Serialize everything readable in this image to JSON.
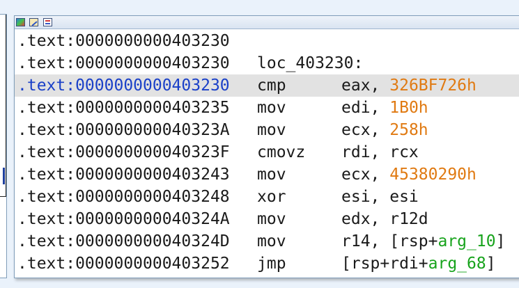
{
  "listing": {
    "lines": [
      {
        "addr": ".text:0000000000403230",
        "mnemonic": "",
        "operands": []
      },
      {
        "addr": ".text:0000000000403230",
        "mnemonic": "loc_403230:",
        "operands": []
      },
      {
        "addr": ".text:0000000000403230",
        "mnemonic": "cmp",
        "selected": true,
        "operands": [
          {
            "t": "eax, ",
            "c": "plain"
          },
          {
            "t": "326BF726h",
            "c": "num"
          }
        ]
      },
      {
        "addr": ".text:0000000000403235",
        "mnemonic": "mov",
        "operands": [
          {
            "t": "edi, ",
            "c": "plain"
          },
          {
            "t": "1B0h",
            "c": "num"
          }
        ]
      },
      {
        "addr": ".text:000000000040323A",
        "mnemonic": "mov",
        "operands": [
          {
            "t": "ecx, ",
            "c": "plain"
          },
          {
            "t": "258h",
            "c": "num"
          }
        ]
      },
      {
        "addr": ".text:000000000040323F",
        "mnemonic": "cmovz",
        "operands": [
          {
            "t": "rdi, rcx",
            "c": "plain"
          }
        ]
      },
      {
        "addr": ".text:0000000000403243",
        "mnemonic": "mov",
        "operands": [
          {
            "t": "ecx, ",
            "c": "plain"
          },
          {
            "t": "45380290h",
            "c": "num"
          }
        ]
      },
      {
        "addr": ".text:0000000000403248",
        "mnemonic": "xor",
        "operands": [
          {
            "t": "esi, esi",
            "c": "plain"
          }
        ]
      },
      {
        "addr": ".text:000000000040324A",
        "mnemonic": "mov",
        "operands": [
          {
            "t": "edx, r12d",
            "c": "plain"
          }
        ]
      },
      {
        "addr": ".text:000000000040324D",
        "mnemonic": "mov",
        "operands": [
          {
            "t": "r14, [rsp+",
            "c": "plain"
          },
          {
            "t": "arg_10",
            "c": "name"
          },
          {
            "t": "]",
            "c": "plain"
          }
        ]
      },
      {
        "addr": ".text:0000000000403252",
        "mnemonic": "jmp",
        "operands": [
          {
            "t": "[rsp+rdi+",
            "c": "plain"
          },
          {
            "t": "arg_68",
            "c": "name"
          },
          {
            "t": "]",
            "c": "plain"
          }
        ]
      }
    ]
  },
  "toolbar": {
    "icons": [
      "graph-view-icon",
      "edit-icon",
      "list-view-icon"
    ]
  },
  "colors": {
    "number": "#e07a12",
    "name": "#17a31c",
    "selected_addr": "#1a40c8",
    "selected_bg": "#e2e2e2"
  }
}
